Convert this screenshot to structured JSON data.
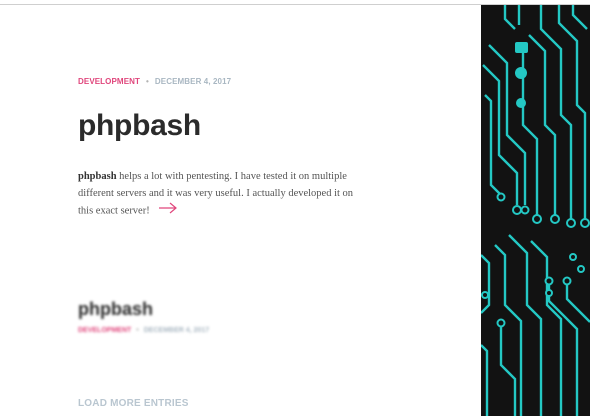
{
  "post": {
    "category": "DEVELOPMENT",
    "date": "DECEMBER 4, 2017",
    "title": "phpbash",
    "excerpt_bold": "phpbash",
    "excerpt_rest": "helps a lot with pentesting. I have tested it on multiple different servers and it was very useful. I actually developed it on this exact server!"
  },
  "next_post": {
    "title": "phpbash",
    "category": "DEVELOPMENT",
    "date": "DECEMBER 4, 2017"
  },
  "load_more": "LOAD MORE ENTRIES",
  "colors": {
    "accent": "#e0467c",
    "date": "#a9b7c2",
    "circuit": "#24c8c4",
    "sidebar_bg": "#121212"
  },
  "icons": {
    "read_more": "arrow-right-icon",
    "sidebar": "circuit-board-image"
  }
}
